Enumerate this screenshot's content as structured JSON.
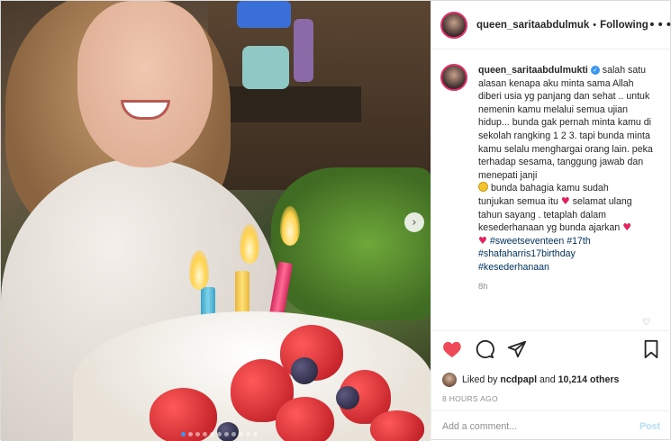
{
  "post": {
    "author": "queen_saritaabdulmuk",
    "separator": "•",
    "follow_state": "Following",
    "more_glyph": "•••",
    "caption_author": "queen_saritaabdulmukti",
    "caption_lines": [
      "salah satu",
      "alasan kenapa aku minta sama Allah",
      "diberi usia yg panjang dan sehat ..",
      "untuk nemenin kamu melalui semua",
      "ujian hidup... bunda gak pernah minta",
      "kamu di sekolah rangking 1 2 3. tapi",
      "bunda minta kamu selalu menghargai",
      "orang lain. peka terhadap sesama,",
      "tanggung jawab dan menepati janji"
    ],
    "caption_after_emoji_1": "bunda bahagia kamu sudah",
    "caption_line_11": "tunjukan semua itu",
    "caption_after_heart_1": "selamat ulang",
    "caption_line_12": "tahun sayang . tetaplah dalam",
    "caption_line_13": "kesederhanaan yg bunda ajarkan",
    "hashtags": {
      "line1": "#sweetseventeen #17th",
      "line2": "#shafaharris17birthday",
      "line3": "#kesederhanaan"
    },
    "caption_time": "8h",
    "liked_by_prefix": "Liked by",
    "liked_by_user": "ncdpapl",
    "liked_by_and": "and",
    "liked_by_count": "10,214 others",
    "timestamp": "8 HOURS AGO",
    "add_comment_placeholder": "Add a comment...",
    "post_button": "Post"
  },
  "media": {
    "next_glyph": "›",
    "carousel_dots": 11,
    "active_dot": 0
  },
  "colors": {
    "heart_liked": "#ed4956",
    "link": "#003569",
    "verified": "#3897f0",
    "post_disabled": "#b2dffc"
  }
}
